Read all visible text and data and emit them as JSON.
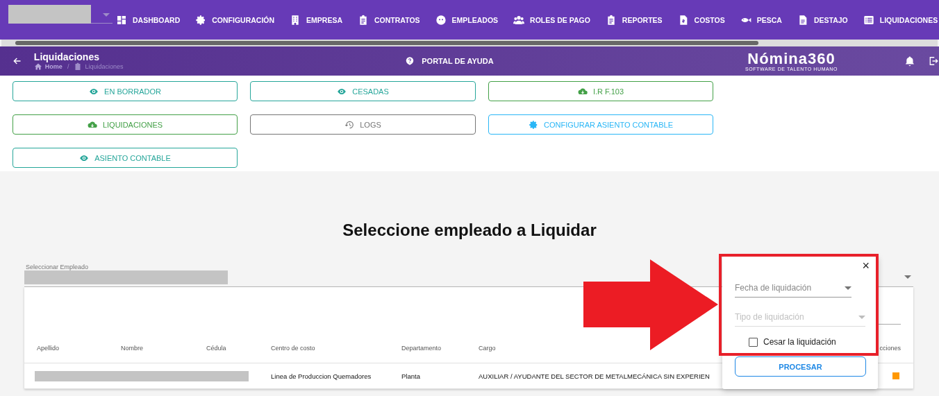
{
  "nav": {
    "items": [
      {
        "label": "DASHBOARD",
        "kind": "dashboard"
      },
      {
        "label": "CONFIGURACIÓN",
        "kind": "gear"
      },
      {
        "label": "EMPRESA",
        "kind": "building"
      },
      {
        "label": "CONTRATOS",
        "kind": "clipboard"
      },
      {
        "label": "EMPLEADOS",
        "kind": "face"
      },
      {
        "label": "ROLES DE PAGO",
        "kind": "people"
      },
      {
        "label": "REPORTES",
        "kind": "clipboard"
      },
      {
        "label": "COSTOS",
        "kind": "invoice"
      },
      {
        "label": "PESCA",
        "kind": "fish"
      },
      {
        "label": "DESTAJO",
        "kind": "document"
      },
      {
        "label": "LIQUIDACIONES",
        "kind": "list"
      }
    ]
  },
  "header": {
    "title": "Liquidaciones",
    "breadcrumb": [
      "Home",
      "Liquidaciones"
    ],
    "breadcrumb_separator": "/",
    "help": "PORTAL DE AYUDA",
    "logo": "Nómina360",
    "tagline": "SOFTWARE DE TALENTO HUMANO"
  },
  "actions": [
    {
      "label": "EN BORRADOR",
      "kind": "eye",
      "color": "#26a69a"
    },
    {
      "label": "CESADAS",
      "kind": "eye",
      "color": "#26a69a"
    },
    {
      "label": "I.R F.103",
      "kind": "cloud",
      "color": "#43a047"
    },
    {
      "label": "LIQUIDACIONES",
      "kind": "cloud",
      "color": "#43a047"
    },
    {
      "label": "LOGS",
      "kind": "history",
      "color": "#757575"
    },
    {
      "label": "CONFIGURAR ASIENTO CONTABLE",
      "kind": "gear",
      "color": "#29b6f6"
    },
    {
      "label": "ASIENTO CONTABLE",
      "kind": "eye",
      "color": "#26a69a"
    }
  ],
  "page_title": "Seleccione empleado a Liquidar",
  "employee_select": {
    "label": "Seleccionar Empleado"
  },
  "table": {
    "columns": [
      "Apellido",
      "Nombre",
      "Cédula",
      "Centro de costo",
      "Departamento",
      "Cargo",
      "cciones"
    ],
    "rows": [
      {
        "centro": "Linea de Produccion Quemadores",
        "departamento": "Planta",
        "cargo": "AUXILIAR / AYUDANTE DEL SECTOR DE METALMECÁNICA SIN EXPERIEN",
        "color": "#ff9800"
      }
    ]
  },
  "dialog": {
    "close": "×",
    "fecha": {
      "placeholder": "Fecha de liquidación"
    },
    "tipo": {
      "placeholder": "Tipo de liquidación",
      "disabled": true
    },
    "cesar": {
      "label": "Cesar la liquidación",
      "checked": false
    },
    "button": "PROCESAR"
  }
}
